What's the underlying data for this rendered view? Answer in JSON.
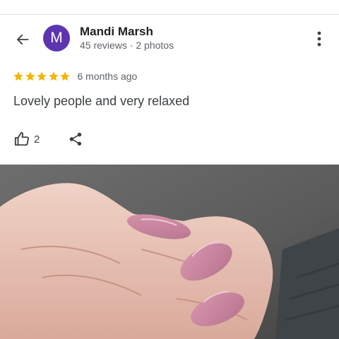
{
  "header": {
    "back_icon": "arrow-back-icon",
    "avatar_letter": "M",
    "avatar_color": "#5e35b1",
    "user_name": "Mandi Marsh",
    "user_meta": "45 reviews · 2 photos",
    "more_icon": "more-vertical-icon"
  },
  "review": {
    "rating": 5,
    "star_color": "#f4b400",
    "time_ago": "6 months ago",
    "text": "Lovely people and very relaxed"
  },
  "actions": {
    "like_icon": "thumbs-up-icon",
    "like_count": "2",
    "share_icon": "share-icon"
  },
  "photo": {
    "subject": "hand with pink almond-shaped nails"
  }
}
